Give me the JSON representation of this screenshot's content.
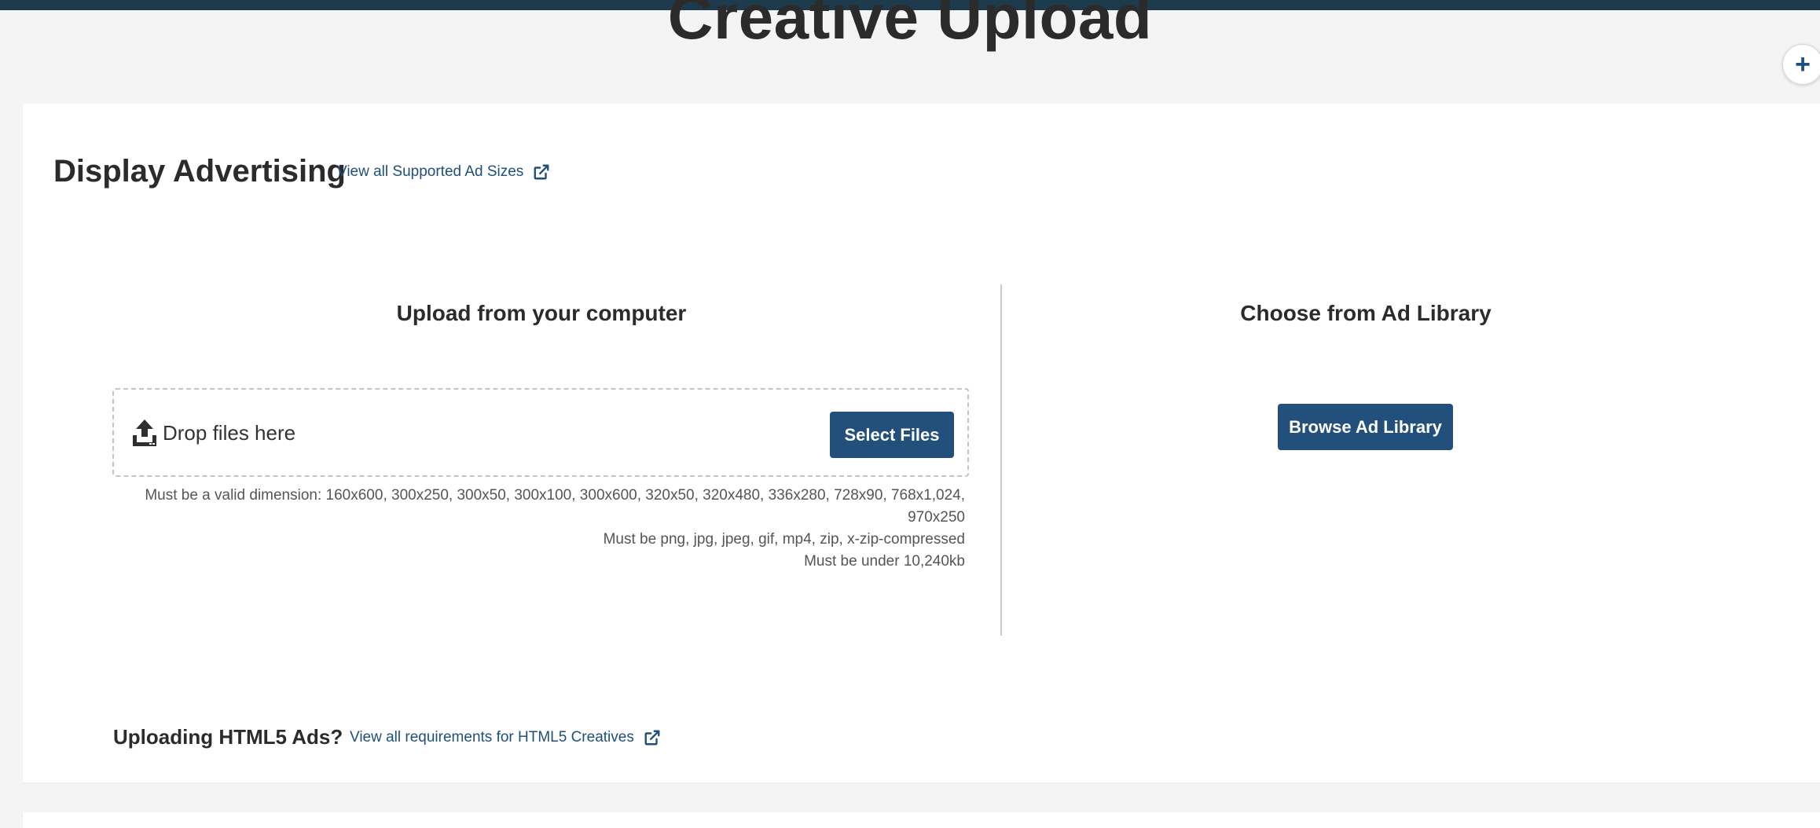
{
  "page": {
    "title": "Creative Upload",
    "add_button_label": "+"
  },
  "display_advertising": {
    "title": "Display Advertising",
    "supported_sizes_link": "View all Supported Ad Sizes"
  },
  "upload_column": {
    "title": "Upload from your computer",
    "drop_text": "Drop files here",
    "select_button": "Select Files",
    "requirements": [
      "Must be a valid dimension: 160x600, 300x250, 300x50, 300x100, 300x600, 320x50, 320x480, 336x280, 728x90, 768x1,024,",
      "970x250",
      "Must be png, jpg, jpeg, gif, mp4, zip, x-zip-compressed",
      "Must be under 10,240kb"
    ]
  },
  "library_column": {
    "title": "Choose from Ad Library",
    "browse_button": "Browse Ad Library"
  },
  "html5": {
    "title": "Uploading HTML5 Ads?",
    "requirements_link": "View all requirements for HTML5 Creatives"
  },
  "colors": {
    "accent": "#234f7d",
    "link": "#1f4f7d",
    "topbar": "#1d3b4c"
  },
  "icons": {
    "external_link": "external-link-icon",
    "upload": "upload-tray-icon",
    "add": "plus-icon"
  }
}
